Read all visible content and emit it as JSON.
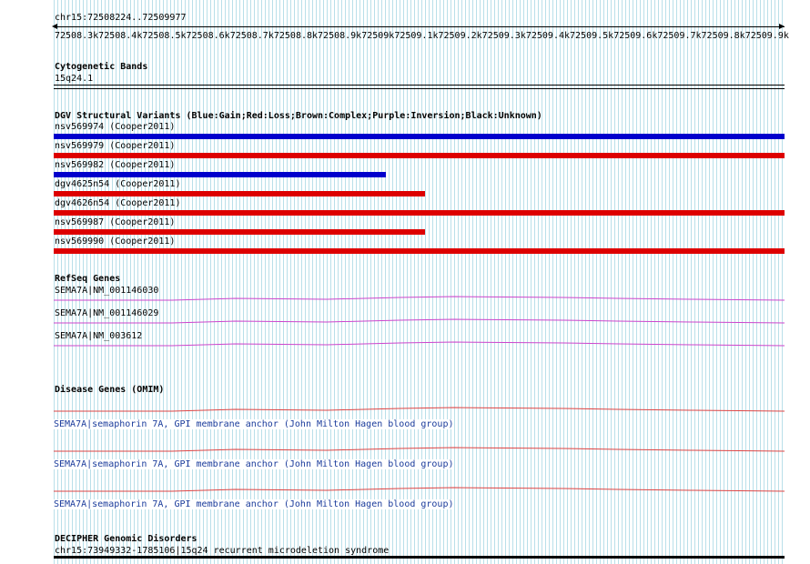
{
  "ruler": {
    "location": "chr15:72508224..72509977",
    "ticks": [
      "72508.3k",
      "72508.4k",
      "72508.5k",
      "72508.6k",
      "72508.7k",
      "72508.8k",
      "72508.9k",
      "72509k",
      "72509.1k",
      "72509.2k",
      "72509.3k",
      "72509.4k",
      "72509.5k",
      "72509.6k",
      "72509.7k",
      "72509.8k",
      "72509.9k"
    ]
  },
  "cytobands": {
    "title": "Cytogenetic Bands",
    "band": "15q24.1"
  },
  "dgv": {
    "title": "DGV Structural Variants (Blue:Gain;Red:Loss;Brown:Complex;Purple:Inversion;Black:Unknown)",
    "variants": [
      {
        "label": "nsv569974 (Cooper2011)",
        "color": "#0000cc",
        "fraction": 1.0
      },
      {
        "label": "nsv569979 (Cooper2011)",
        "color": "#dd0000",
        "fraction": 1.0
      },
      {
        "label": "nsv569982 (Cooper2011)",
        "color": "#0000cc",
        "fraction": 0.455
      },
      {
        "label": "dgv4625n54 (Cooper2011)",
        "color": "#dd0000",
        "fraction": 0.508
      },
      {
        "label": "dgv4626n54 (Cooper2011)",
        "color": "#dd0000",
        "fraction": 1.0
      },
      {
        "label": "nsv569987 (Cooper2011)",
        "color": "#dd0000",
        "fraction": 0.508
      },
      {
        "label": "nsv569990 (Cooper2011)",
        "color": "#dd0000",
        "fraction": 1.0
      }
    ]
  },
  "refseq": {
    "title": "RefSeq Genes",
    "color": "#cc44cc",
    "genes": [
      {
        "label": "SEMA7A|NM_001146030"
      },
      {
        "label": "SEMA7A|NM_001146029"
      },
      {
        "label": "SEMA7A|NM_003612"
      }
    ]
  },
  "omim": {
    "title": "Disease Genes (OMIM)",
    "color": "#dd4444",
    "genes": [
      {
        "label": "SEMA7A|semaphorin 7A, GPI membrane anchor (John Milton Hagen blood group)"
      },
      {
        "label": "SEMA7A|semaphorin 7A, GPI membrane anchor (John Milton Hagen blood group)"
      },
      {
        "label": "SEMA7A|semaphorin 7A, GPI membrane anchor (John Milton Hagen blood group)"
      }
    ]
  },
  "decipher": {
    "title": "DECIPHER Genomic Disorders",
    "entry": "chr15:73949332-1785106|15q24 recurrent microdeletion syndrome"
  }
}
